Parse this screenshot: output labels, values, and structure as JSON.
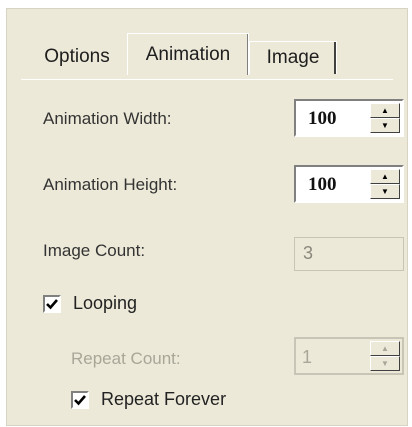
{
  "tabs": [
    {
      "label": "Options",
      "selected": false
    },
    {
      "label": "Animation",
      "selected": true
    },
    {
      "label": "Image",
      "selected": false
    }
  ],
  "fields": {
    "animation_width": {
      "label": "Animation Width:",
      "value": "100"
    },
    "animation_height": {
      "label": "Animation Height:",
      "value": "100"
    },
    "image_count": {
      "label": "Image Count:",
      "value": "3"
    },
    "repeat_count": {
      "label": "Repeat Count:",
      "value": "1",
      "enabled": false
    }
  },
  "checkboxes": {
    "looping": {
      "label": "Looping",
      "checked": true
    },
    "repeat_forever": {
      "label": "Repeat Forever",
      "checked": true
    }
  },
  "icons": {
    "spinner_up": "chevron-up-icon",
    "spinner_down": "chevron-down-icon",
    "check": "check-icon"
  },
  "colors": {
    "panel_bg": "#ece9d8",
    "disabled_text": "#a8a698"
  }
}
